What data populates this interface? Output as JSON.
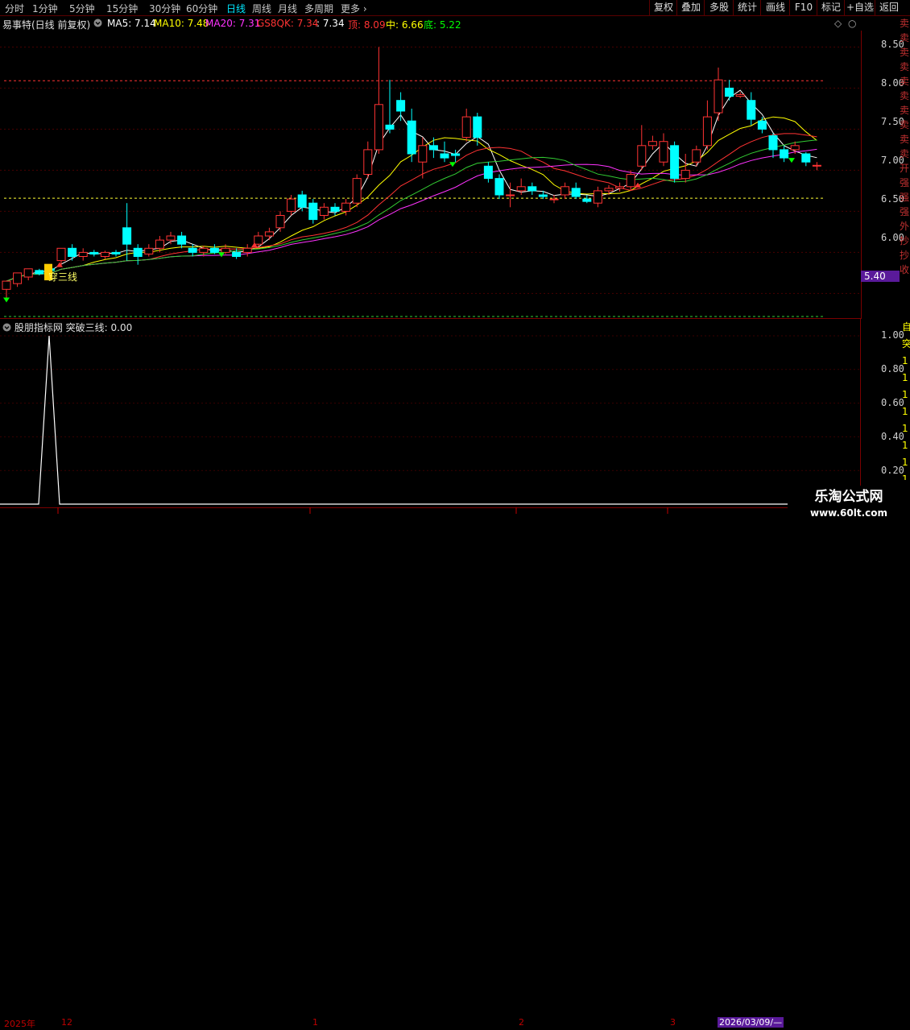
{
  "toolbar": {
    "timeframes": [
      "分时",
      "1分钟",
      "5分钟",
      "15分钟",
      "30分钟",
      "60分钟",
      "日线",
      "周线",
      "月线",
      "多周期",
      "更多"
    ],
    "active_timeframe": "日线",
    "right_buttons": [
      "复权",
      "叠加",
      "多股",
      "统计",
      "画线",
      "F10",
      "标记",
      "+自选",
      "返回"
    ]
  },
  "chart_header": {
    "stock": "易事特(日线 前复权)",
    "ma5": "MA5: 7.14",
    "ma10": "MA10: 7.48",
    "ma20": "MA20: 7.31",
    "gs8qk": "GS8QK: 7.34",
    "gs8qk_val2": ": 7.34",
    "top": "顶: 8.09",
    "mid": "中: 6.66",
    "bottom": "底: 5.22"
  },
  "price_axis": {
    "labels": [
      "8.50",
      "8.00",
      "7.50",
      "7.00",
      "6.50",
      "6.00"
    ],
    "current_tag": "5.40"
  },
  "annotation": "穿三线",
  "indicator": {
    "title": "股朋指标网 突破三线: 0.00",
    "axis_labels": [
      "1.00",
      "0.80",
      "0.60",
      "0.40",
      "0.20"
    ]
  },
  "side_column_text": "卖卖卖卖卖卖卖卖卖卖开强强强外抄抄收",
  "side_column_text2": "自突1111111111",
  "dates": {
    "year": "2025年",
    "m12": "12",
    "m1": "1",
    "m2": "2",
    "m3": "3",
    "cursor_date": "2026/03/09/—"
  },
  "watermark": {
    "line1": "乐淘公式网",
    "line2": "www.60lt.com"
  },
  "chart_data": {
    "type": "candlestick",
    "y_range": [
      5.2,
      8.7
    ],
    "reference_lines": {
      "top": 8.09,
      "mid": 6.66,
      "bottom": 5.22
    },
    "candles": [
      [
        5.55,
        5.65,
        5.45,
        5.6
      ],
      [
        5.62,
        5.75,
        5.58,
        5.7
      ],
      [
        5.7,
        5.8,
        5.66,
        5.78
      ],
      [
        5.78,
        5.74,
        5.72,
        5.8
      ],
      [
        5.8,
        5.78,
        5.7,
        5.85
      ],
      [
        5.9,
        6.05,
        5.85,
        6.05
      ],
      [
        6.05,
        5.95,
        5.9,
        6.1
      ],
      [
        5.95,
        6.0,
        5.9,
        6.05
      ],
      [
        6.0,
        5.98,
        5.95,
        6.03
      ],
      [
        5.95,
        6.0,
        5.92,
        6.02
      ],
      [
        6.0,
        5.98,
        5.95,
        6.03
      ],
      [
        6.3,
        6.1,
        5.9,
        6.6
      ],
      [
        6.05,
        5.95,
        5.85,
        6.1
      ],
      [
        5.98,
        6.05,
        5.95,
        6.1
      ],
      [
        6.05,
        6.15,
        6.0,
        6.2
      ],
      [
        6.15,
        6.2,
        6.1,
        6.25
      ],
      [
        6.2,
        6.1,
        6.05,
        6.25
      ],
      [
        6.05,
        6.0,
        5.95,
        6.1
      ],
      [
        6.0,
        6.05,
        5.95,
        6.08
      ],
      [
        6.05,
        6.0,
        5.98,
        6.1
      ],
      [
        6.0,
        6.05,
        5.98,
        6.1
      ],
      [
        6.0,
        5.95,
        5.92,
        6.05
      ],
      [
        6.0,
        6.05,
        5.95,
        6.1
      ],
      [
        6.1,
        6.2,
        6.05,
        6.25
      ],
      [
        6.2,
        6.25,
        6.15,
        6.3
      ],
      [
        6.3,
        6.45,
        6.25,
        6.5
      ],
      [
        6.5,
        6.65,
        6.45,
        6.7
      ],
      [
        6.7,
        6.55,
        6.5,
        6.75
      ],
      [
        6.6,
        6.4,
        6.35,
        6.65
      ],
      [
        6.45,
        6.55,
        6.4,
        6.6
      ],
      [
        6.55,
        6.5,
        6.45,
        6.6
      ],
      [
        6.5,
        6.6,
        6.45,
        6.65
      ],
      [
        6.6,
        6.9,
        6.55,
        6.95
      ],
      [
        6.95,
        7.25,
        6.9,
        7.35
      ],
      [
        7.25,
        7.8,
        7.2,
        8.5
      ],
      [
        7.55,
        7.5,
        7.45,
        8.1
      ],
      [
        7.85,
        7.72,
        7.6,
        7.95
      ],
      [
        7.6,
        7.2,
        7.1,
        7.75
      ],
      [
        7.1,
        7.3,
        6.9,
        7.4
      ],
      [
        7.3,
        7.25,
        7.15,
        7.4
      ],
      [
        7.2,
        7.15,
        7.1,
        7.35
      ],
      [
        7.2,
        7.18,
        7.1,
        7.25
      ],
      [
        7.4,
        7.65,
        7.35,
        7.75
      ],
      [
        7.65,
        7.4,
        7.3,
        7.7
      ],
      [
        7.05,
        6.9,
        6.85,
        7.1
      ],
      [
        6.9,
        6.7,
        6.65,
        6.95
      ],
      [
        6.7,
        6.7,
        6.55,
        6.85
      ],
      [
        6.75,
        6.8,
        6.7,
        6.9
      ],
      [
        6.8,
        6.75,
        6.7,
        6.85
      ],
      [
        6.7,
        6.68,
        6.65,
        6.75
      ],
      [
        6.65,
        6.65,
        6.6,
        6.7
      ],
      [
        6.7,
        6.8,
        6.65,
        6.85
      ],
      [
        6.78,
        6.68,
        6.65,
        6.85
      ],
      [
        6.65,
        6.62,
        6.6,
        6.7
      ],
      [
        6.6,
        6.75,
        6.55,
        6.8
      ],
      [
        6.75,
        6.78,
        6.7,
        6.82
      ],
      [
        6.78,
        6.8,
        6.74,
        6.85
      ],
      [
        6.8,
        6.95,
        6.75,
        7.0
      ],
      [
        7.05,
        7.3,
        7.0,
        7.55
      ],
      [
        7.3,
        7.35,
        7.25,
        7.42
      ],
      [
        7.1,
        7.35,
        7.05,
        7.45
      ],
      [
        7.3,
        6.9,
        6.85,
        7.35
      ],
      [
        6.9,
        7.0,
        6.85,
        7.2
      ],
      [
        7.1,
        7.25,
        7.05,
        7.3
      ],
      [
        7.3,
        7.65,
        7.25,
        7.85
      ],
      [
        7.7,
        8.1,
        7.6,
        8.25
      ],
      [
        8.0,
        7.9,
        7.85,
        8.1
      ],
      [
        7.9,
        7.92,
        7.88,
        7.95
      ],
      [
        7.85,
        7.62,
        7.55,
        7.95
      ],
      [
        7.6,
        7.5,
        7.45,
        7.65
      ],
      [
        7.42,
        7.25,
        7.15,
        7.45
      ],
      [
        7.25,
        7.15,
        7.1,
        7.3
      ],
      [
        7.25,
        7.3,
        7.2,
        7.35
      ],
      [
        7.2,
        7.1,
        7.05,
        7.22
      ],
      [
        7.05,
        7.06,
        7.0,
        7.1
      ]
    ],
    "indicator_series": {
      "name": "突破三线",
      "y_range": [
        0,
        1.0
      ],
      "spike_index": 3,
      "spike_value": 1.0
    }
  }
}
